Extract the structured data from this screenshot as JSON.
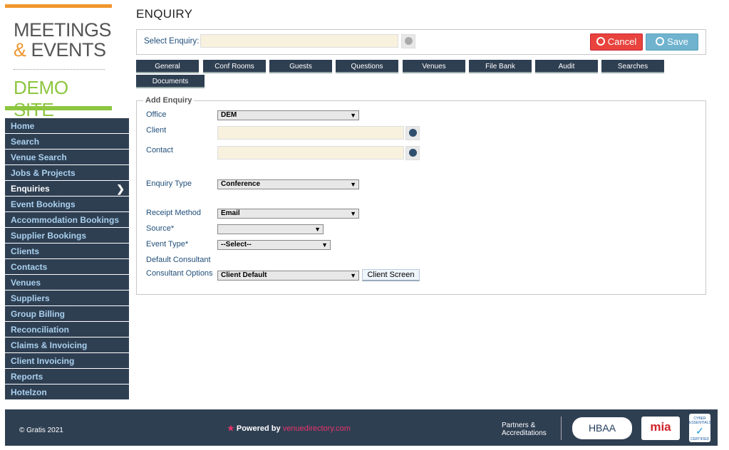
{
  "logo": {
    "line1": "MEETINGS",
    "amp": "&",
    "line2": " EVENTS",
    "demo": "DEMO SITE"
  },
  "nav": {
    "items": [
      {
        "label": "Home",
        "name": "nav-home",
        "active": false
      },
      {
        "label": "Search",
        "name": "nav-search",
        "active": false
      },
      {
        "label": "Venue Search",
        "name": "nav-venue-search",
        "active": false
      },
      {
        "label": "Jobs & Projects",
        "name": "nav-jobs-projects",
        "active": false
      },
      {
        "label": "Enquiries",
        "name": "nav-enquiries",
        "active": true
      },
      {
        "label": "Event Bookings",
        "name": "nav-event-bookings",
        "active": false
      },
      {
        "label": "Accommodation Bookings",
        "name": "nav-accommodation-bookings",
        "active": false
      },
      {
        "label": "Supplier Bookings",
        "name": "nav-supplier-bookings",
        "active": false
      },
      {
        "label": "Clients",
        "name": "nav-clients",
        "active": false
      },
      {
        "label": "Contacts",
        "name": "nav-contacts",
        "active": false
      },
      {
        "label": "Venues",
        "name": "nav-venues",
        "active": false
      },
      {
        "label": "Suppliers",
        "name": "nav-suppliers",
        "active": false
      },
      {
        "label": "Group Billing",
        "name": "nav-group-billing",
        "active": false
      },
      {
        "label": "Reconciliation",
        "name": "nav-reconciliation",
        "active": false
      },
      {
        "label": "Claims & Invoicing",
        "name": "nav-claims-invoicing",
        "active": false
      },
      {
        "label": "Client Invoicing",
        "name": "nav-client-invoicing",
        "active": false
      },
      {
        "label": "Reports",
        "name": "nav-reports",
        "active": false
      },
      {
        "label": "Hotelzon",
        "name": "nav-hotelzon",
        "active": false
      }
    ]
  },
  "page": {
    "title": "ENQUIRY"
  },
  "select_enquiry": {
    "label": "Select Enquiry:",
    "value": ""
  },
  "buttons": {
    "cancel": "Cancel",
    "save": "Save",
    "client_screen": "Client Screen"
  },
  "tabs": [
    {
      "label": "General"
    },
    {
      "label": "Conf Rooms"
    },
    {
      "label": "Guests"
    },
    {
      "label": "Questions"
    },
    {
      "label": "Venues"
    },
    {
      "label": "File Bank"
    },
    {
      "label": "Audit"
    },
    {
      "label": "Searches"
    },
    {
      "label": "Documents"
    }
  ],
  "form": {
    "legend": "Add Enquiry",
    "office": {
      "label": "Office",
      "value": "DEM"
    },
    "client": {
      "label": "Client",
      "value": ""
    },
    "contact": {
      "label": "Contact",
      "value": ""
    },
    "enquiry_type": {
      "label": "Enquiry Type",
      "value": "Conference"
    },
    "receipt_method": {
      "label": "Receipt Method",
      "value": "Email"
    },
    "source": {
      "label": "Source*",
      "value": ""
    },
    "event_type": {
      "label": "Event Type*",
      "value": "--Select--"
    },
    "default_consultant": {
      "label": "Default Consultant"
    },
    "consultant_options": {
      "label": "Consultant Options",
      "value": "Client Default"
    }
  },
  "footer": {
    "copyright": "© Gratis 2021",
    "powered_prefix": "Powered by",
    "powered_brand": "venuedirectory.com",
    "partners_line1": "Partners &",
    "partners_line2": "Accreditations",
    "hbaa": "HBAA",
    "mia": "mia",
    "cyber_line1": "CYBER",
    "cyber_line2": "ESSENTIALS",
    "cyber_line3": "CERTIFIED"
  },
  "colors": {
    "nav_bg": "#2f3f52",
    "accent_orange": "#f0962e",
    "accent_green": "#8dc63f",
    "cancel": "#e8433d",
    "save": "#6fb3cf",
    "input_bg": "#f7f1de"
  }
}
